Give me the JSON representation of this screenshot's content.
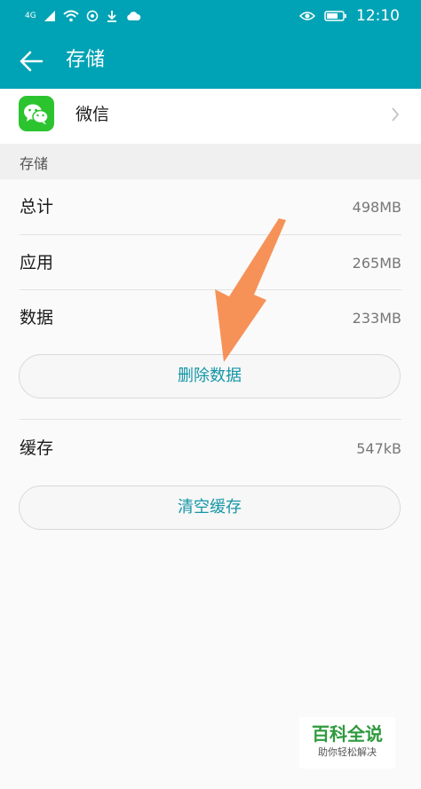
{
  "status_bar": {
    "signal_text": "4G",
    "time": "12:10"
  },
  "header": {
    "title": "存储"
  },
  "app": {
    "name": "微信"
  },
  "section": {
    "title": "存储"
  },
  "storage": {
    "rows": [
      {
        "label": "总计",
        "value": "498MB"
      },
      {
        "label": "应用",
        "value": "265MB"
      },
      {
        "label": "数据",
        "value": "233MB"
      }
    ],
    "clear_data_label": "删除数据",
    "cache": {
      "label": "缓存",
      "value": "547kB"
    },
    "clear_cache_label": "清空缓存"
  },
  "watermark": {
    "main": "百科全说",
    "sub": "助你轻松解决"
  },
  "colors": {
    "header_bg": "#00a3b5",
    "button_text": "#1496a6",
    "arrow": "#f5894a",
    "wechat_green": "#2bc42f"
  }
}
